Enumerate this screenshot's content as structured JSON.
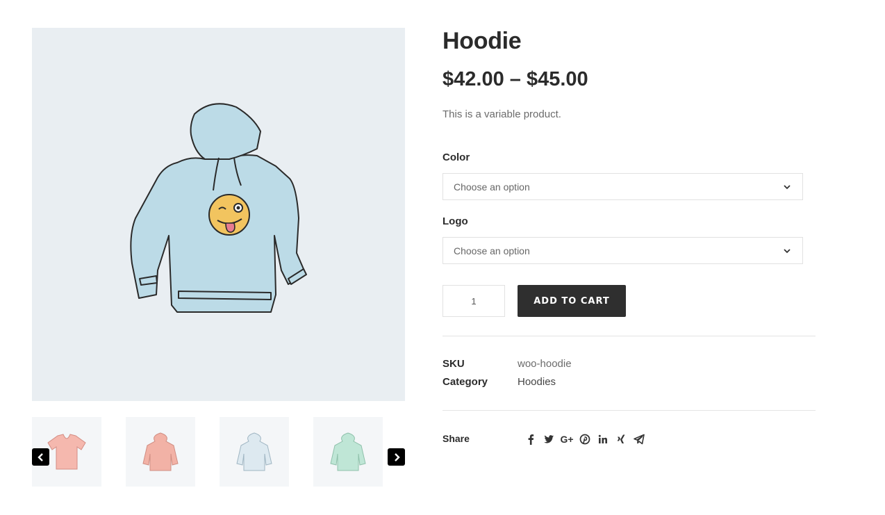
{
  "product": {
    "title": "Hoodie",
    "price": "$42.00 – $45.00",
    "short_description": "This is a variable product."
  },
  "gallery": {
    "main_image": "hoodie-blue-winking-emoji",
    "thumbnails": [
      {
        "name": "pink-vneck-tshirt",
        "color": "#f5b8ae"
      },
      {
        "name": "pink-hoodie",
        "color": "#f2b2a6"
      },
      {
        "name": "light-blue-hoodie",
        "color": "#cfe0ea"
      },
      {
        "name": "mint-hoodie",
        "color": "#bfe6d6"
      }
    ],
    "prev_icon": "chevron-left-icon",
    "next_icon": "chevron-right-icon"
  },
  "variations": [
    {
      "label": "Color",
      "placeholder": "Choose an option"
    },
    {
      "label": "Logo",
      "placeholder": "Choose an option"
    }
  ],
  "cart": {
    "quantity": "1",
    "button_label": "ADD TO CART"
  },
  "meta": {
    "sku_label": "SKU",
    "sku_value": "woo-hoodie",
    "category_label": "Category",
    "category_value": "Hoodies"
  },
  "share": {
    "label": "Share",
    "icons": [
      "facebook-icon",
      "twitter-icon",
      "google-plus-icon",
      "pinterest-icon",
      "linkedin-icon",
      "xing-icon",
      "telegram-icon"
    ]
  },
  "colors": {
    "text_dark": "#2b2b2b",
    "text_muted": "#6b6b6b",
    "button_bg": "#2f2f2f",
    "image_bg": "#e9eef2",
    "hoodie_fill": "#bcdbe7",
    "emoji_fill": "#f2c45f"
  }
}
